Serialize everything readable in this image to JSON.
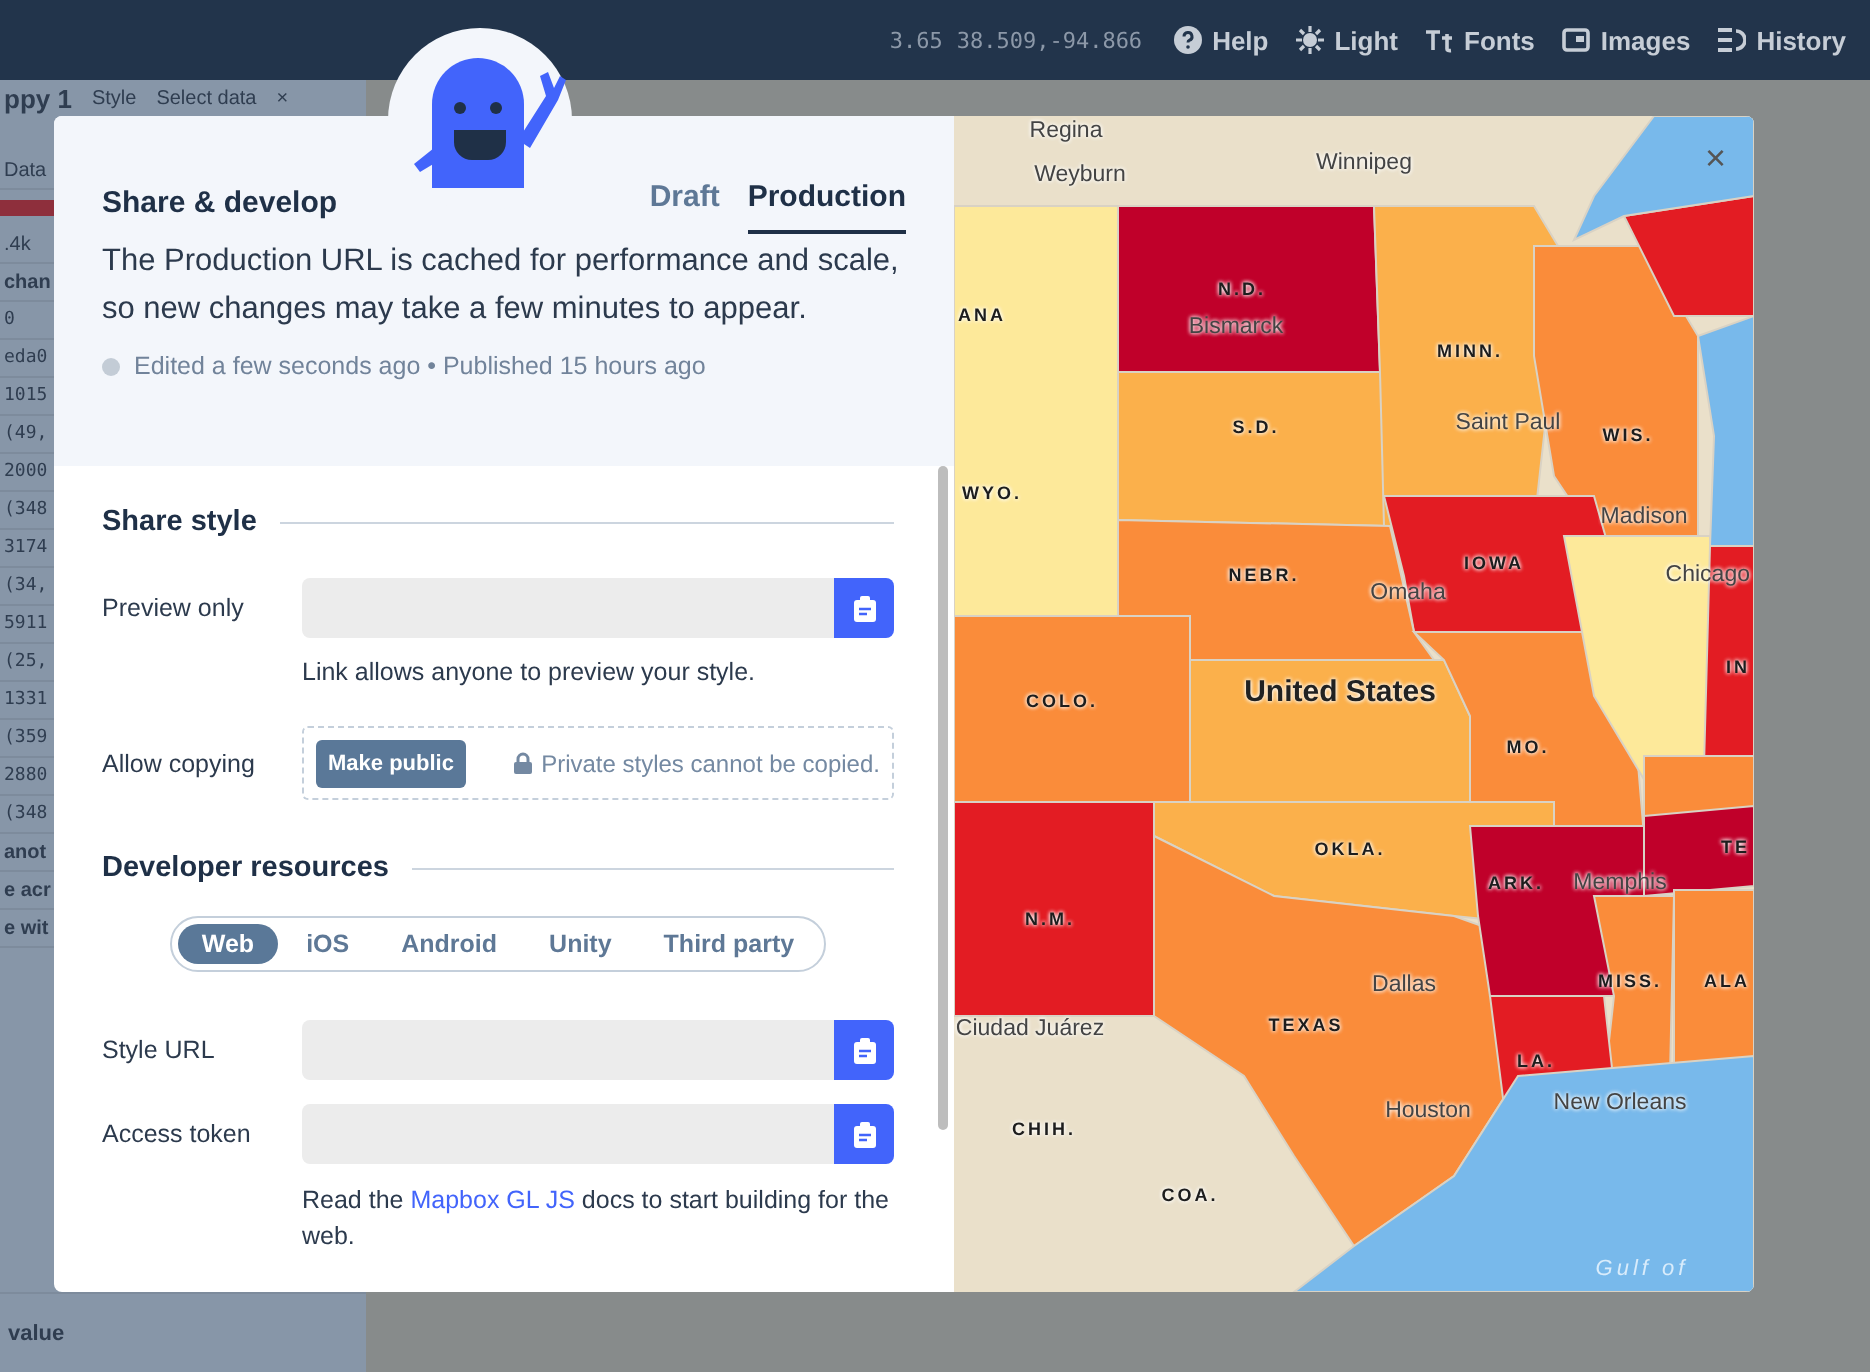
{
  "top_bar": {
    "zoom": "3.65",
    "coordinates": "38.509,-94.866",
    "items": [
      {
        "label": "Help"
      },
      {
        "label": "Light"
      },
      {
        "label": "Fonts"
      },
      {
        "label": "Images"
      },
      {
        "label": "History"
      }
    ]
  },
  "sidebar": {
    "title": "ppy 1",
    "tabs": [
      "Style",
      "Select data"
    ],
    "close": "×",
    "rows": [
      {
        "kind": "text",
        "text": "Data"
      },
      {
        "kind": "bar"
      },
      {
        "kind": "text",
        "text": ".4k"
      },
      {
        "kind": "bold",
        "text": "chan"
      },
      {
        "kind": "mono",
        "text": "0"
      },
      {
        "kind": "mono",
        "text": "eda0"
      },
      {
        "kind": "mono",
        "text": "1015"
      },
      {
        "kind": "mono",
        "text": "(49,"
      },
      {
        "kind": "mono",
        "text": "2000"
      },
      {
        "kind": "mono",
        "text": "(348"
      },
      {
        "kind": "mono",
        "text": "3174"
      },
      {
        "kind": "mono",
        "text": "(34,"
      },
      {
        "kind": "mono",
        "text": "5911"
      },
      {
        "kind": "mono",
        "text": "(25,"
      },
      {
        "kind": "mono",
        "text": "1331"
      },
      {
        "kind": "mono",
        "text": "(359"
      },
      {
        "kind": "mono",
        "text": "2880"
      },
      {
        "kind": "mono",
        "text": "(348"
      },
      {
        "kind": "bold",
        "text": "anot"
      },
      {
        "kind": "bold",
        "text": "e acr"
      },
      {
        "kind": "bold",
        "text": "e wit"
      },
      {
        "kind": "bold",
        "text": "value"
      }
    ]
  },
  "dialog": {
    "title": "Share & develop",
    "tabs": [
      {
        "label": "Draft",
        "selected": false
      },
      {
        "label": "Production",
        "selected": true
      }
    ],
    "description": "The Production URL is cached for performance and scale, so new changes may take a few minutes to appear.",
    "status": "Edited a few seconds ago • Published 15 hours ago",
    "share_style": {
      "heading": "Share style",
      "preview_label": "Preview only",
      "preview_hint": "Link allows anyone to preview your style.",
      "copy_label": "Allow copying",
      "make_public": "Make public",
      "private_note": "Private styles cannot be copied."
    },
    "developer": {
      "heading": "Developer resources",
      "platforms": [
        {
          "label": "Web",
          "selected": true
        },
        {
          "label": "iOS",
          "selected": false
        },
        {
          "label": "Android",
          "selected": false
        },
        {
          "label": "Unity",
          "selected": false
        },
        {
          "label": "Third party",
          "selected": false
        }
      ],
      "fields": [
        {
          "label": "Style URL"
        },
        {
          "label": "Access token"
        }
      ],
      "note_before": "Read the",
      "note_link": "Mapbox GL JS",
      "note_after": "docs to start building for the web."
    },
    "close": "×"
  },
  "map": {
    "labels": [
      {
        "text": "Regina",
        "kind": "city"
      },
      {
        "text": "Weyburn",
        "kind": "city"
      },
      {
        "text": "Winnipeg",
        "kind": "city"
      },
      {
        "text": "ANA",
        "kind": "state"
      },
      {
        "text": "N.D.",
        "kind": "state"
      },
      {
        "text": "Bismarck",
        "kind": "city"
      },
      {
        "text": "MINN.",
        "kind": "state"
      },
      {
        "text": "S.D.",
        "kind": "state"
      },
      {
        "text": "Saint Paul",
        "kind": "city"
      },
      {
        "text": "WIS.",
        "kind": "state"
      },
      {
        "text": "WYO.",
        "kind": "state"
      },
      {
        "text": "Madison",
        "kind": "city"
      },
      {
        "text": "IOWA",
        "kind": "state"
      },
      {
        "text": "NEBR.",
        "kind": "state"
      },
      {
        "text": "Chicago",
        "kind": "city"
      },
      {
        "text": "Omaha",
        "kind": "city"
      },
      {
        "text": "IN",
        "kind": "state"
      },
      {
        "text": "COLO.",
        "kind": "state"
      },
      {
        "text": "United States",
        "kind": "country"
      },
      {
        "text": "MO.",
        "kind": "state"
      },
      {
        "text": "OKLA.",
        "kind": "state"
      },
      {
        "text": "TE",
        "kind": "state"
      },
      {
        "text": "ARK.",
        "kind": "state"
      },
      {
        "text": "Memphis",
        "kind": "city"
      },
      {
        "text": "N.M.",
        "kind": "state"
      },
      {
        "text": "Dallas",
        "kind": "city"
      },
      {
        "text": "MISS.",
        "kind": "state"
      },
      {
        "text": "ALA",
        "kind": "state"
      },
      {
        "text": "Ciudad Juárez",
        "kind": "city"
      },
      {
        "text": "TEXAS",
        "kind": "state"
      },
      {
        "text": "LA.",
        "kind": "state"
      },
      {
        "text": "Houston",
        "kind": "city"
      },
      {
        "text": "New Orleans",
        "kind": "city"
      },
      {
        "text": "CHIH.",
        "kind": "state"
      },
      {
        "text": "COA.",
        "kind": "state"
      },
      {
        "text": "Gulf of",
        "kind": "water"
      }
    ]
  }
}
